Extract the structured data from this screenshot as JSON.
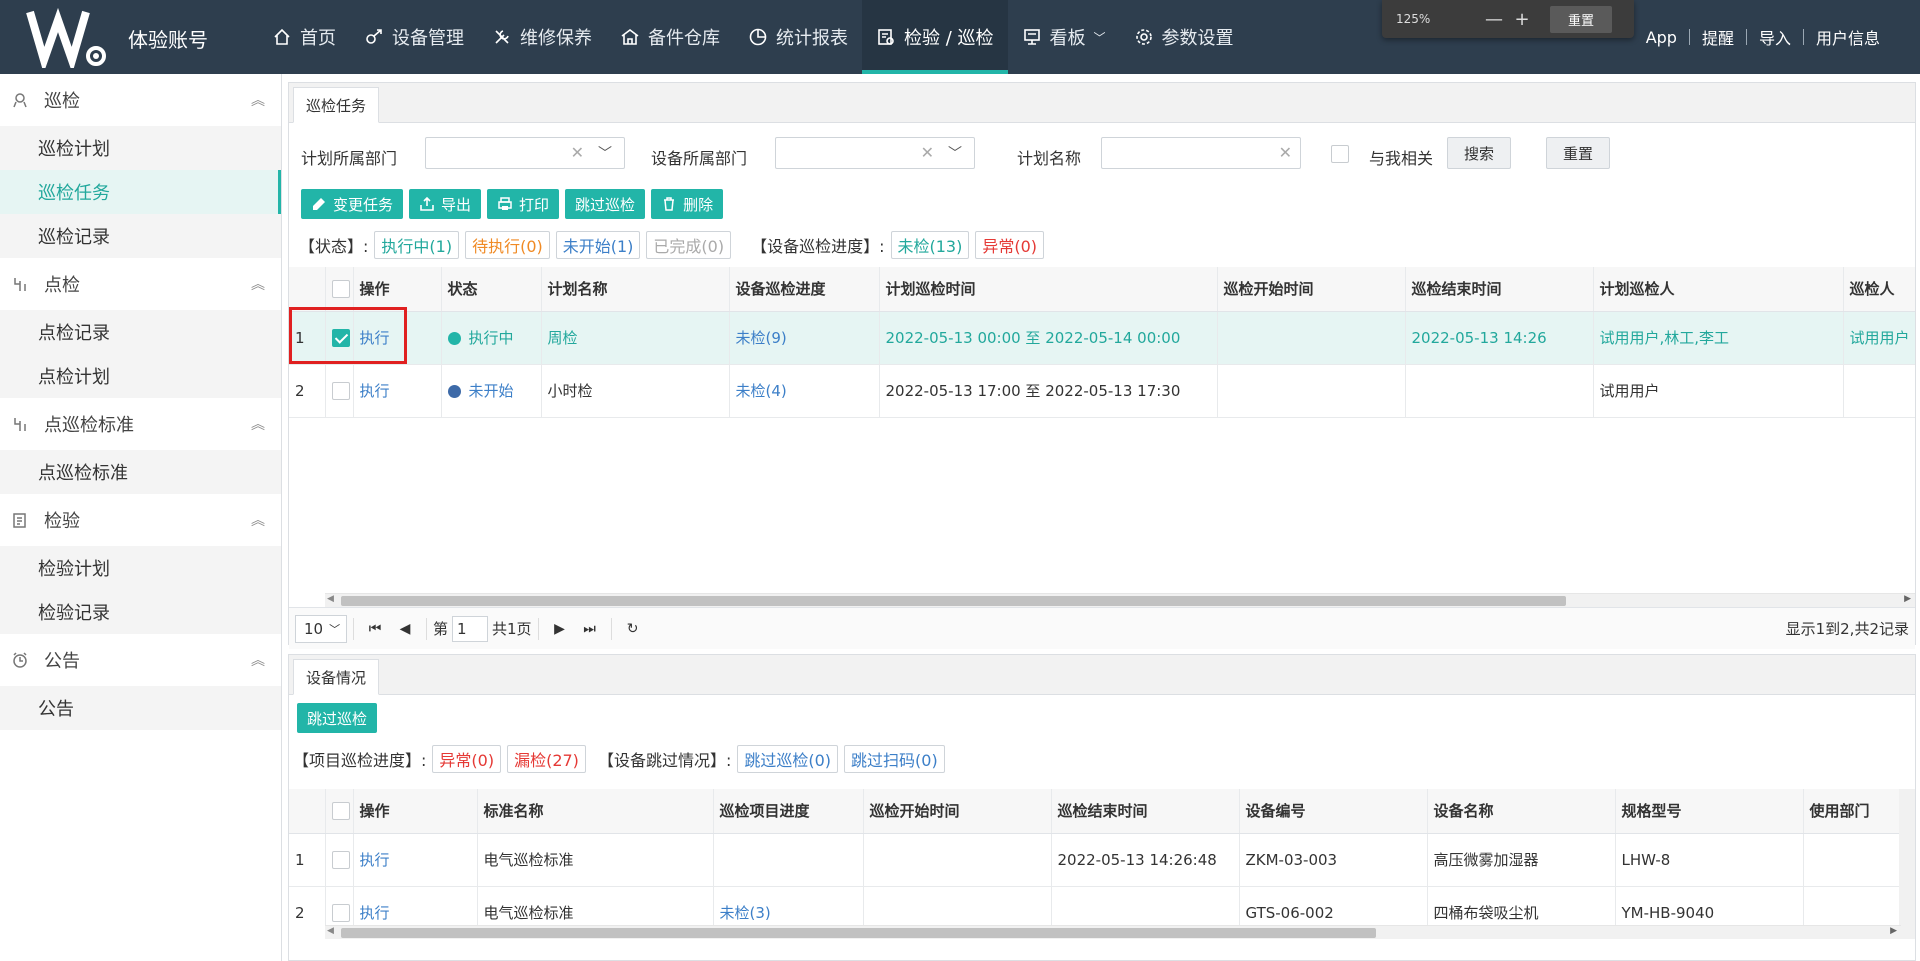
{
  "brand": {
    "logo_letter": "W",
    "name": "体验账号"
  },
  "nav": [
    {
      "label": "首页",
      "icon": "home-icon"
    },
    {
      "label": "设备管理",
      "icon": "equipment-icon"
    },
    {
      "label": "维修保养",
      "icon": "wrench-icon"
    },
    {
      "label": "备件仓库",
      "icon": "warehouse-icon"
    },
    {
      "label": "统计报表",
      "icon": "pie-chart-icon"
    },
    {
      "label": "检验 / 巡检",
      "icon": "inspection-icon",
      "active": true
    },
    {
      "label": "看板",
      "icon": "board-icon"
    },
    {
      "label": "参数设置",
      "icon": "gear-icon"
    }
  ],
  "zoom": {
    "percent": "125%",
    "minus": "—",
    "plus": "+",
    "reset": "重置"
  },
  "right_links": [
    "App",
    "提醒",
    "导入",
    "用户信息"
  ],
  "sidebar": {
    "groups": [
      {
        "label": "巡检",
        "icon": "patrol-icon",
        "items": [
          "巡检计划",
          "巡检任务",
          "巡检记录"
        ]
      },
      {
        "label": "点检",
        "icon": "spot-check-icon",
        "items": [
          "点检记录",
          "点检计划"
        ]
      },
      {
        "label": "点巡检标准",
        "icon": "standard-icon",
        "items": [
          "点巡检标准"
        ]
      },
      {
        "label": "检验",
        "icon": "clipboard-icon",
        "items": [
          "检验计划",
          "检验记录"
        ]
      },
      {
        "label": "公告",
        "icon": "announcement-icon",
        "items": [
          "公告"
        ]
      }
    ],
    "active_item": "巡检任务"
  },
  "task_panel": {
    "tab": "巡检任务",
    "filters": {
      "plan_dept_label": "计划所属部门",
      "equip_dept_label": "设备所属部门",
      "plan_name_label": "计划名称",
      "related_label": "与我相关",
      "search_btn": "搜索",
      "reset_btn": "重置"
    },
    "toolbar": [
      "变更任务",
      "导出",
      "打印",
      "跳过巡检",
      "删除"
    ],
    "status_prefix": "【状态】:",
    "status_tags": [
      "执行中(1)",
      "待执行(0)",
      "未开始(1)",
      "已完成(0)"
    ],
    "progress_prefix": "【设备巡检进度】:",
    "progress_tags": [
      "未检(13)",
      "异常(0)"
    ],
    "columns": [
      "操作",
      "状态",
      "计划名称",
      "设备巡检进度",
      "计划巡检时间",
      "巡检开始时间",
      "巡检结束时间",
      "计划巡检人",
      "巡检人"
    ],
    "rows": [
      {
        "no": "1",
        "op": "执行",
        "status": "执行中",
        "status_color": "#22b5a8",
        "name": "周检",
        "progress": "未检(9)",
        "plan_time": "2022-05-13 00:00 至 2022-05-14 00:00",
        "start": "",
        "end": "2022-05-13 14:26",
        "planner": "试用用户,林工,李工",
        "inspector": "试用用户"
      },
      {
        "no": "2",
        "op": "执行",
        "status": "未开始",
        "status_color": "#3d6aa8",
        "name": "小时检",
        "progress": "未检(4)",
        "plan_time": "2022-05-13 17:00 至 2022-05-13 17:30",
        "start": "",
        "end": "",
        "planner": "试用用户",
        "inspector": ""
      }
    ],
    "pager": {
      "size": "10",
      "page_prefix": "第",
      "page": "1",
      "total_pages": "共1页",
      "info": "显示1到2,共2记录"
    }
  },
  "equip_panel": {
    "tab": "设备情况",
    "skip_btn": "跳过巡检",
    "item_prefix": "【项目巡检进度】:",
    "item_tags": [
      "异常(0)",
      "漏检(27)"
    ],
    "skip_prefix": "【设备跳过情况】:",
    "skip_tags": [
      "跳过巡检(0)",
      "跳过扫码(0)"
    ],
    "columns": [
      "操作",
      "标准名称",
      "巡检项目进度",
      "巡检开始时间",
      "巡检结束时间",
      "设备编号",
      "设备名称",
      "规格型号",
      "使用部门"
    ],
    "rows": [
      {
        "no": "1",
        "op": "执行",
        "standard": "电气巡检标准",
        "progress": "",
        "start": "",
        "end": "2022-05-13 14:26:48",
        "code": "ZKM-03-003",
        "name": "高压微雾加湿器",
        "model": "LHW-8",
        "dept": ""
      },
      {
        "no": "2",
        "op": "执行",
        "standard": "电气巡检标准",
        "progress": "未检(3)",
        "start": "",
        "end": "",
        "code": "GTS-06-002",
        "name": "四桶布袋吸尘机",
        "model": "YM-HB-9040",
        "dept": ""
      }
    ]
  }
}
